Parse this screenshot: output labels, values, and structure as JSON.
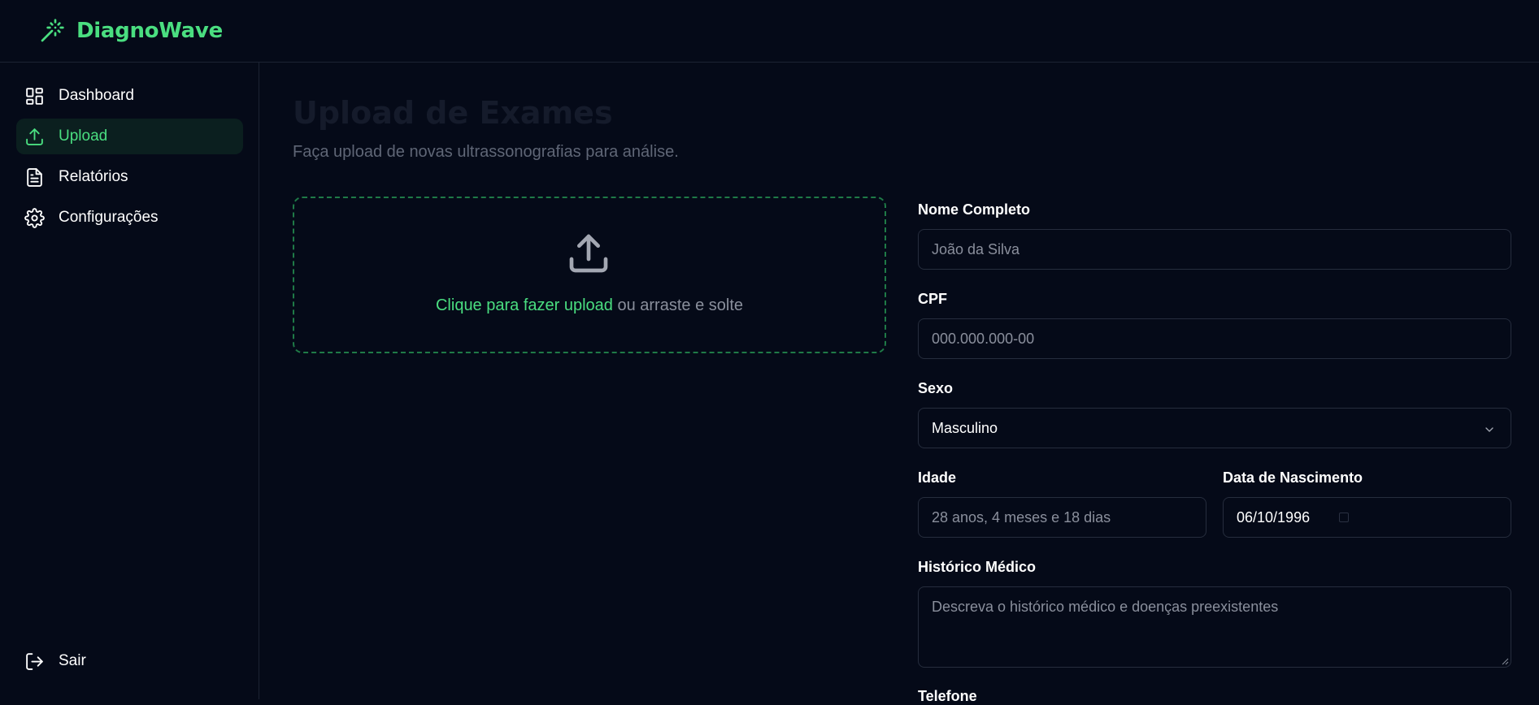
{
  "brand": {
    "name": "DiagnoWave",
    "icon": "magic-wand-icon",
    "accent": "#4ade80"
  },
  "sidebar": {
    "items": [
      {
        "label": "Dashboard",
        "icon": "dashboard-grid-icon",
        "active": false
      },
      {
        "label": "Upload",
        "icon": "upload-icon",
        "active": true
      },
      {
        "label": "Relatórios",
        "icon": "document-icon",
        "active": false
      },
      {
        "label": "Configurações",
        "icon": "gear-icon",
        "active": false
      }
    ],
    "logout": {
      "label": "Sair",
      "icon": "logout-icon"
    }
  },
  "main": {
    "title": "Upload de Exames",
    "subtitle": "Faça upload de novas ultrassonografias para análise.",
    "dropzone": {
      "link": "Clique para fazer upload",
      "rest": " ou arraste e solte",
      "icon": "upload-icon"
    }
  },
  "form": {
    "name": {
      "label": "Nome Completo",
      "placeholder": "João da Silva"
    },
    "cpf": {
      "label": "CPF",
      "placeholder": "000.000.000-00"
    },
    "sex": {
      "label": "Sexo",
      "value": "Masculino"
    },
    "age": {
      "label": "Idade",
      "placeholder": "28 anos, 4 meses e 18 dias"
    },
    "birth": {
      "label": "Data de Nascimento",
      "value": "06/10/1996"
    },
    "history": {
      "label": "Histórico Médico",
      "placeholder": "Descreva o histórico médico e doenças preexistentes"
    },
    "phone": {
      "label": "Telefone"
    }
  }
}
